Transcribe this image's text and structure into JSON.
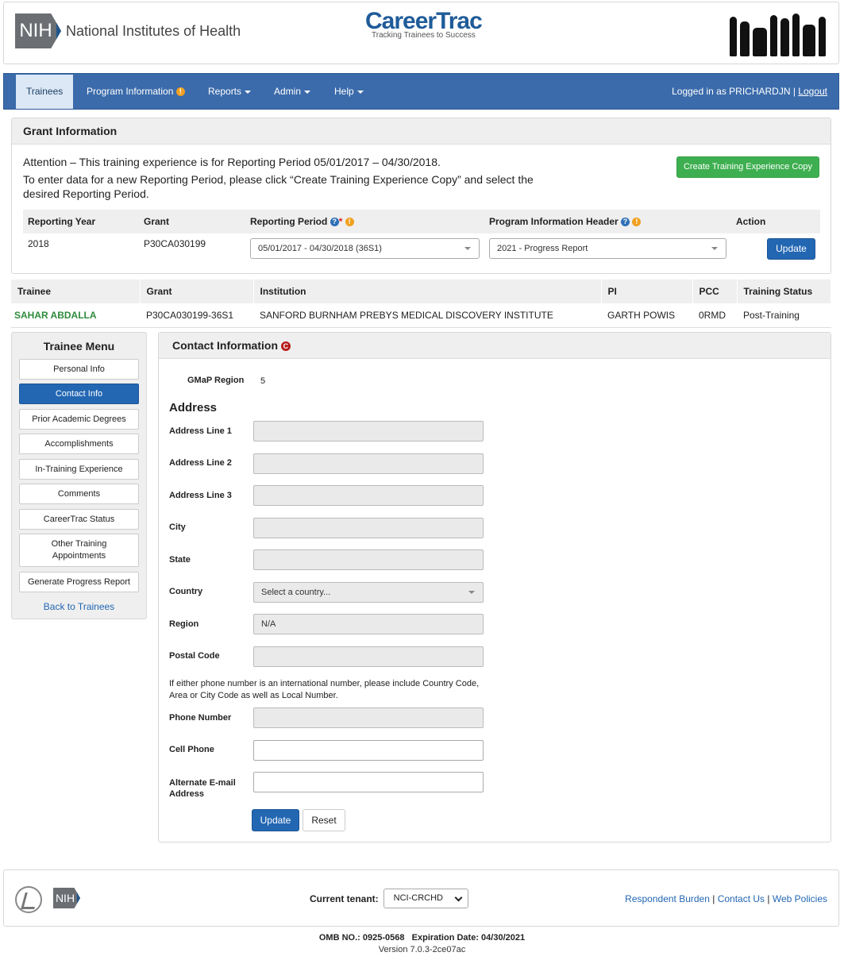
{
  "header": {
    "nih_box": "NIH",
    "nih_name": "National Institutes of Health",
    "app_title_a": "Career",
    "app_title_b": "Trac",
    "tagline": "Tracking Trainees to Success"
  },
  "nav": {
    "items": [
      {
        "label": "Trainees"
      },
      {
        "label": "Program Information"
      },
      {
        "label": "Reports"
      },
      {
        "label": "Admin"
      },
      {
        "label": "Help"
      }
    ],
    "logged_in_prefix": "Logged in as PRICHARDJN | ",
    "logout": "Logout"
  },
  "grant": {
    "title": "Grant Information",
    "attention_1": "Attention – This training experience is for Reporting Period 05/01/2017 – 04/30/2018.",
    "attention_2": "To enter data for a new Reporting Period, please click “Create Training Experience Copy” and select the desired Reporting Period.",
    "create_copy_button": "Create Training Experience Copy",
    "columns": {
      "year": "Reporting Year",
      "grant": "Grant",
      "period": "Reporting Period",
      "header": "Program Information Header",
      "action": "Action"
    },
    "row": {
      "year": "2018",
      "grant": "P30CA030199",
      "period": "05/01/2017 - 04/30/2018 (36S1)",
      "header": "2021 - Progress Report",
      "update": "Update"
    }
  },
  "trainee_table": {
    "columns": [
      "Trainee",
      "Grant",
      "Institution",
      "PI",
      "PCC",
      "Training Status"
    ],
    "row": [
      "SAHAR ABDALLA",
      "P30CA030199-36S1",
      "SANFORD BURNHAM PREBYS MEDICAL DISCOVERY INSTITUTE",
      "GARTH POWIS",
      "0RMD",
      "Post-Training"
    ]
  },
  "sidebar": {
    "title": "Trainee Menu",
    "items": [
      {
        "label": "Personal Info"
      },
      {
        "label": "Contact Info"
      },
      {
        "label": "Prior Academic Degrees"
      },
      {
        "label": "Accomplishments"
      },
      {
        "label": "In-Training Experience"
      },
      {
        "label": "Comments"
      },
      {
        "label": "CareerTrac Status"
      },
      {
        "label": "Other Training Appointments"
      },
      {
        "label": "Generate Progress Report"
      }
    ],
    "back_link": "Back to Trainees"
  },
  "contact": {
    "title": "Contact Information",
    "gmap_label": "GMaP Region",
    "gmap_value": "5",
    "address_title": "Address",
    "fields": {
      "address1": "Address Line 1",
      "address2": "Address Line 2",
      "address3": "Address Line 3",
      "city": "City",
      "state": "State",
      "country": "Country",
      "country_placeholder": "Select a country...",
      "region": "Region",
      "region_value": "N/A",
      "postal": "Postal Code",
      "phone_note": "If either phone number is an international number, please include Country Code, Area or City Code as well as Local Number.",
      "phone": "Phone Number",
      "cell": "Cell Phone",
      "alt_email": "Alternate E-mail Address"
    },
    "update_button": "Update",
    "reset_button": "Reset"
  },
  "footer": {
    "nih_box": "NIH",
    "tenant_label": "Current tenant:",
    "tenant_value": "NCI-CRCHD",
    "links": [
      "Respondent Burden",
      "Contact Us",
      "Web Policies"
    ],
    "omb": "OMB NO.: 0925-0568   Expiration Date: 04/30/2021",
    "version": "Version 7.0.3-2ce07ac"
  },
  "colors": {
    "nav_bg": "#3b6bab",
    "primary_button": "#2367b3",
    "create_button": "#3eaf50",
    "trainee_name": "#2e8b3c",
    "warning_badge": "#f0a020"
  }
}
